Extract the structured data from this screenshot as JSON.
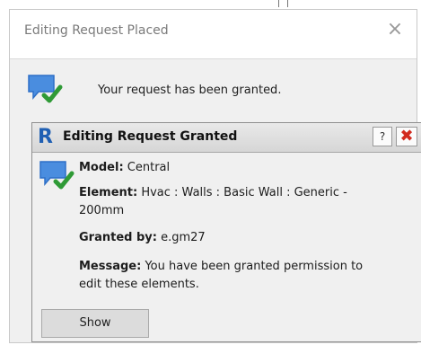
{
  "outer_dialog": {
    "title": "Editing Request Placed",
    "close_glyph": "×",
    "message": "Your request has been granted."
  },
  "inner_dialog": {
    "logo": "R",
    "title": "Editing Request Granted",
    "help_label": "?",
    "close_glyph": "✖",
    "fields": {
      "model_label": "Model:",
      "model_value": "Central",
      "element_label": "Element:",
      "element_value": "Hvac : Walls : Basic Wall : Generic - 200mm",
      "granted_by_label": "Granted by:",
      "granted_by_value": "e.gm27",
      "message_label": "Message:",
      "message_value": "You have been granted permission to edit these elements."
    },
    "show_button": "Show"
  },
  "icons": {
    "notification": "speech-bubble-check-icon",
    "app_logo": "revit-logo"
  },
  "colors": {
    "bubble": "#3b7dd8",
    "check": "#2f9a36",
    "close_red": "#d22a1e"
  }
}
